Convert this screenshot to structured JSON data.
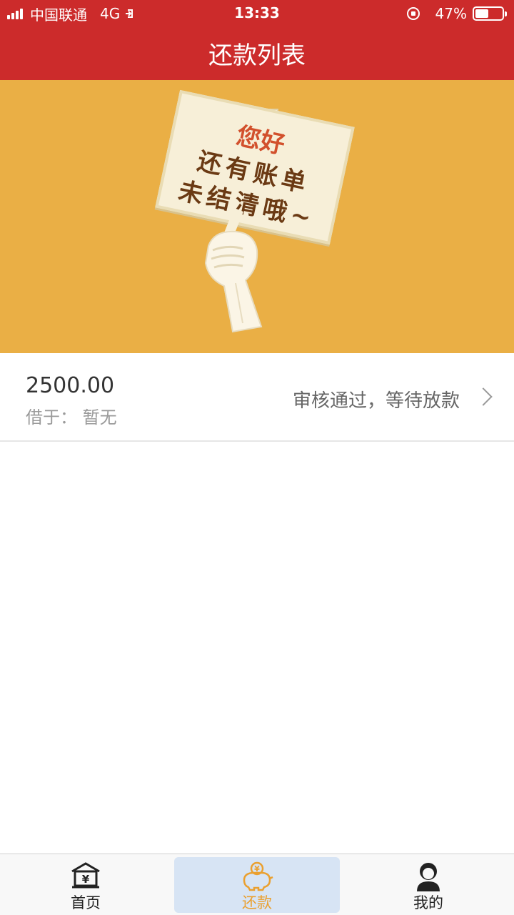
{
  "status_bar": {
    "carrier": "中国联通",
    "network": "4G",
    "time": "13:33",
    "battery": "47%"
  },
  "header": {
    "title": "还款列表"
  },
  "banner": {
    "line1": "您好",
    "line2": "还有账单",
    "line3": "未结清哦~"
  },
  "loan": {
    "amount": "2500.00",
    "lender": "借于：  暂无",
    "status": "审核通过，等待放款"
  },
  "tabbar": {
    "tabs": [
      {
        "label": "首页",
        "icon": "bank-icon"
      },
      {
        "label": "还款",
        "icon": "piggy-bank-icon"
      },
      {
        "label": "我的",
        "icon": "user-icon"
      }
    ],
    "active_index": 1
  },
  "colors": {
    "header_bg": "#cc2b2b",
    "banner_bg": "#eaaf45",
    "active_tab": "#eaa030"
  }
}
